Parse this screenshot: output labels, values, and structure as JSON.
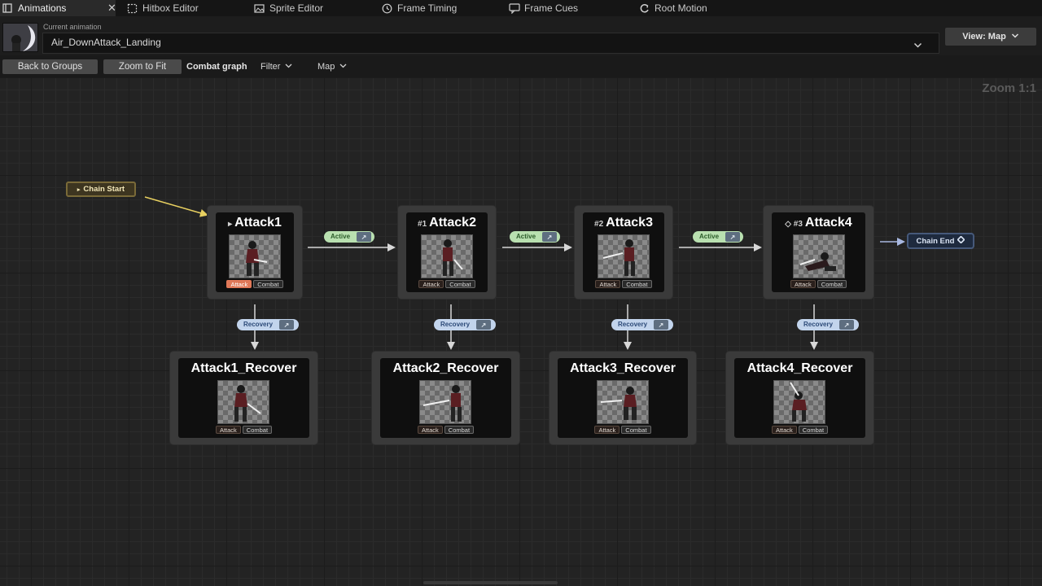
{
  "tabs": [
    {
      "label": "Animations",
      "icon": "window-icon",
      "active": true
    },
    {
      "label": "Hitbox Editor",
      "icon": "dashed-box-icon"
    },
    {
      "label": "Sprite Editor",
      "icon": "image-icon"
    },
    {
      "label": "Frame Timing",
      "icon": "clock-icon"
    },
    {
      "label": "Frame Cues",
      "icon": "cue-icon"
    },
    {
      "label": "Root Motion",
      "icon": "root-motion-icon"
    }
  ],
  "close_glyph": "✕",
  "current_animation": {
    "label": "Current animation",
    "value": "Air_DownAttack_Landing"
  },
  "view_button": "View: Map",
  "toolbar": {
    "back": "Back to Groups",
    "zoom_fit": "Zoom to Fit",
    "combat_graph": "Combat graph",
    "filter": "Filter",
    "map": "Map"
  },
  "zoom_label": "Zoom 1:1",
  "chain_start": "Chain Start",
  "chain_end": "Chain End",
  "attack_nodes": [
    {
      "prefix": "▸",
      "title": "Attack1",
      "tags": [
        "Attack",
        "Combat"
      ],
      "highlight": true
    },
    {
      "prefix": "#1",
      "title": "Attack2",
      "tags": [
        "Attack",
        "Combat"
      ]
    },
    {
      "prefix": "#2",
      "title": "Attack3",
      "tags": [
        "Attack",
        "Combat"
      ]
    },
    {
      "prefix": "◇ #3",
      "title": "Attack4",
      "tags": [
        "Attack",
        "Combat"
      ]
    }
  ],
  "recover_nodes": [
    {
      "title": "Attack1_Recover",
      "tags": [
        "Attack",
        "Combat"
      ]
    },
    {
      "title": "Attack2_Recover",
      "tags": [
        "Attack",
        "Combat"
      ]
    },
    {
      "title": "Attack3_Recover",
      "tags": [
        "Attack",
        "Combat"
      ]
    },
    {
      "title": "Attack4_Recover",
      "tags": [
        "Attack",
        "Combat"
      ]
    }
  ],
  "transitions": {
    "active": "Active",
    "recovery": "Recovery"
  },
  "colors": {
    "accent_attack_tag": "#e07858",
    "active_pill": "#b9e0b0",
    "recovery_pill": "#c2d4ec",
    "chain_start_wire": "#e8d060"
  }
}
